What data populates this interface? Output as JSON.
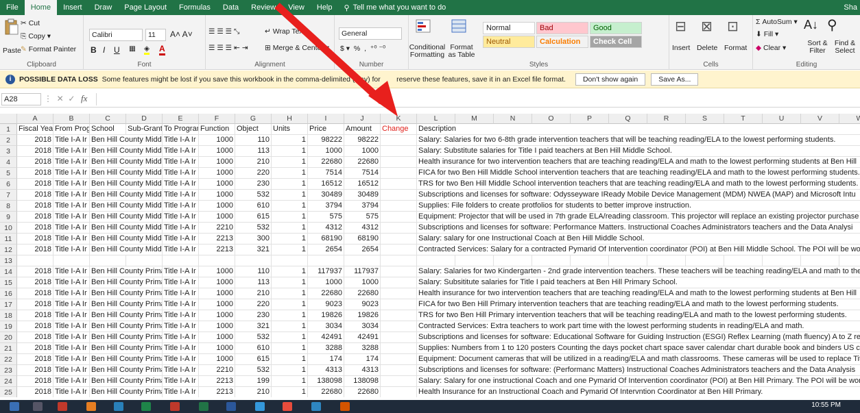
{
  "tabs": [
    "File",
    "Home",
    "Insert",
    "Draw",
    "Page Layout",
    "Formulas",
    "Data",
    "Review",
    "View",
    "Help"
  ],
  "tell_me": "Tell me what you want to do",
  "share": "Sha",
  "clipboard": {
    "paste": "Paste",
    "cut": "Cut",
    "copy": "Copy",
    "format_painter": "Format Painter",
    "label": "Clipboard"
  },
  "font": {
    "name": "Calibri",
    "size": "11",
    "label": "Font",
    "bold": "B",
    "italic": "I",
    "underline": "U"
  },
  "alignment": {
    "wrap": "Wrap Text",
    "merge": "Merge & Center",
    "label": "Alignment"
  },
  "number": {
    "format": "General",
    "label": "Number",
    "dollar": "$",
    "percent": "%",
    "comma": ","
  },
  "styles": {
    "conditional": "Conditional Formatting",
    "format_table": "Format as Table",
    "cells": [
      {
        "label": "Normal",
        "bg": "#ffffff",
        "fg": "#222222"
      },
      {
        "label": "Bad",
        "bg": "#ffc7ce",
        "fg": "#9c0006"
      },
      {
        "label": "Good",
        "bg": "#c6efce",
        "fg": "#006100"
      },
      {
        "label": "Neutral",
        "bg": "#ffeb9c",
        "fg": "#9c5700"
      },
      {
        "label": "Calculation",
        "bg": "#f2f2f2",
        "fg": "#fa7d00"
      },
      {
        "label": "Check Cell",
        "bg": "#a5a5a5",
        "fg": "#ffffff"
      }
    ],
    "label": "Styles"
  },
  "cells_group": {
    "insert": "Insert",
    "delete": "Delete",
    "format": "Format",
    "label": "Cells"
  },
  "editing": {
    "autosum": "AutoSum",
    "fill": "Fill",
    "clear": "Clear",
    "sort": "Sort & Filter",
    "find": "Find & Select",
    "label": "Editing"
  },
  "message": {
    "title": "POSSIBLE DATA LOSS",
    "text": "Some features might be lost if you save this workbook in the comma-delimited (.csv) for",
    "text2": "reserve these features, save it in an Excel file format.",
    "btn1": "Don't show again",
    "btn2": "Save As..."
  },
  "name_box": "A28",
  "fx": "fx",
  "columns": [
    "A",
    "B",
    "C",
    "D",
    "E",
    "F",
    "G",
    "H",
    "I",
    "J",
    "K",
    "L",
    "M",
    "N",
    "O",
    "P",
    "Q",
    "R",
    "S",
    "T",
    "U",
    "V",
    "W"
  ],
  "headers": [
    "Fiscal Year",
    "From Prog",
    "School",
    "Sub-Grant",
    "To Program",
    "Function",
    "Object",
    "Units",
    "Price",
    "Amount",
    "Change",
    "Description"
  ],
  "rows": [
    {
      "n": "1"
    },
    {
      "n": "2",
      "y": "2018",
      "p": "Title I-A  Ir",
      "s": "Ben Hill County Middl",
      "t": "Title I-A  Ir",
      "f": "1000",
      "o": "110",
      "u": "1",
      "pr": "98222",
      "a": "98222",
      "d": "Salary:  Salaries for two 6-8th grade intervention teachers that will be teaching reading/ELA to the lowest performing students."
    },
    {
      "n": "3",
      "y": "2018",
      "p": "Title I-A  Ir",
      "s": "Ben Hill County Middl",
      "t": "Title I-A  Ir",
      "f": "1000",
      "o": "113",
      "u": "1",
      "pr": "1000",
      "a": "1000",
      "d": "Salary:  Substitute salaries for Title I paid teachers at Ben Hill Middle School."
    },
    {
      "n": "4",
      "y": "2018",
      "p": "Title I-A  Ir",
      "s": "Ben Hill County Middl",
      "t": "Title I-A  Ir",
      "f": "1000",
      "o": "210",
      "u": "1",
      "pr": "22680",
      "a": "22680",
      "d": "Health insurance for two intervention teachers that are teaching reading/ELA and math to the lowest performing students at Ben Hill"
    },
    {
      "n": "5",
      "y": "2018",
      "p": "Title I-A  Ir",
      "s": "Ben Hill County Middl",
      "t": "Title I-A  Ir",
      "f": "1000",
      "o": "220",
      "u": "1",
      "pr": "7514",
      "a": "7514",
      "d": "FICA for two Ben Hill Middle School intervention teachers that are teaching reading/ELA and math to the lowest performing students."
    },
    {
      "n": "6",
      "y": "2018",
      "p": "Title I-A  Ir",
      "s": "Ben Hill County Middl",
      "t": "Title I-A  Ir",
      "f": "1000",
      "o": "230",
      "u": "1",
      "pr": "16512",
      "a": "16512",
      "d": "TRS for two Ben Hill Middle School intervention teachers that are teaching reading/ELA and math to the lowest performing students."
    },
    {
      "n": "7",
      "y": "2018",
      "p": "Title I-A  Ir",
      "s": "Ben Hill County Middl",
      "t": "Title I-A  Ir",
      "f": "1000",
      "o": "532",
      "u": "1",
      "pr": "30489",
      "a": "30489",
      "d": "Subscriptions and licenses for software:  Odysseyware  IReady  Mobile Device Management (MDM)  NWEA (MAP)  and Microsoft Intu"
    },
    {
      "n": "8",
      "y": "2018",
      "p": "Title I-A  Ir",
      "s": "Ben Hill County Middl",
      "t": "Title I-A  Ir",
      "f": "1000",
      "o": "610",
      "u": "1",
      "pr": "3794",
      "a": "3794",
      "d": "Supplies:  File folders to create protfolios for students to better improve instruction."
    },
    {
      "n": "9",
      "y": "2018",
      "p": "Title I-A  Ir",
      "s": "Ben Hill County Middl",
      "t": "Title I-A  Ir",
      "f": "1000",
      "o": "615",
      "u": "1",
      "pr": "575",
      "a": "575",
      "d": "Equipment:  Projector that will be used in 7th grade ELA/reading classroom.  This projector will replace an existing projector purchase"
    },
    {
      "n": "10",
      "y": "2018",
      "p": "Title I-A  Ir",
      "s": "Ben Hill County Middl",
      "t": "Title I-A  Ir",
      "f": "2210",
      "o": "532",
      "u": "1",
      "pr": "4312",
      "a": "4312",
      "d": "Subscriptions and licenses for software:  Performance Matters.  Instructional Coaches  Administrators  teachers  and the Data Analysi"
    },
    {
      "n": "11",
      "y": "2018",
      "p": "Title I-A  Ir",
      "s": "Ben Hill County Middl",
      "t": "Title I-A  Ir",
      "f": "2213",
      "o": "300",
      "u": "1",
      "pr": "68190",
      "a": "68190",
      "d": "Salary:  salary for one Instructional Coach at Ben Hill Middle School."
    },
    {
      "n": "12",
      "y": "2018",
      "p": "Title I-A  Ir",
      "s": "Ben Hill County Middl",
      "t": "Title I-A  Ir",
      "f": "2213",
      "o": "321",
      "u": "1",
      "pr": "2654",
      "a": "2654",
      "d": "Contracted Services:  Salary for a contracted Pymarid Of Intervention coordinator (POI) at Ben Hill Middle School.  The POI will be wo"
    },
    {
      "n": "13"
    },
    {
      "n": "14",
      "y": "2018",
      "p": "Title I-A  Ir",
      "s": "Ben Hill County Prima",
      "t": "Title I-A  Ir",
      "f": "1000",
      "o": "110",
      "u": "1",
      "pr": "117937",
      "a": "117937",
      "d": "Salary:  Salaries for two Kindergarten - 2nd grade intervention teachers.  These teachers will be teaching reading/ELA and math to the"
    },
    {
      "n": "15",
      "y": "2018",
      "p": "Title I-A  Ir",
      "s": "Ben Hill County Prima",
      "t": "Title I-A  Ir",
      "f": "1000",
      "o": "113",
      "u": "1",
      "pr": "1000",
      "a": "1000",
      "d": "Salary:  Subsititute salaries for Title I paid teachers at Ben Hill Primary School."
    },
    {
      "n": "16",
      "y": "2018",
      "p": "Title I-A  Ir",
      "s": "Ben Hill County Prima",
      "t": "Title I-A  Ir",
      "f": "1000",
      "o": "210",
      "u": "1",
      "pr": "22680",
      "a": "22680",
      "d": "Health insurance for two intervention teachers that are teaching reading/ELA and math to the lowest performing students at Ben Hill"
    },
    {
      "n": "17",
      "y": "2018",
      "p": "Title I-A  Ir",
      "s": "Ben Hill County Prima",
      "t": "Title I-A  Ir",
      "f": "1000",
      "o": "220",
      "u": "1",
      "pr": "9023",
      "a": "9023",
      "d": "FICA for two Ben Hill Primary intervention teachers that are teaching reading/ELA and math to the lowest performing students."
    },
    {
      "n": "18",
      "y": "2018",
      "p": "Title I-A  Ir",
      "s": "Ben Hill County Prima",
      "t": "Title I-A  Ir",
      "f": "1000",
      "o": "230",
      "u": "1",
      "pr": "19826",
      "a": "19826",
      "d": "TRS for two Ben Hill Primary intervention teachers that will be teaching reading/ELA and math to the lowest performing students."
    },
    {
      "n": "19",
      "y": "2018",
      "p": "Title I-A  Ir",
      "s": "Ben Hill County Prima",
      "t": "Title I-A  Ir",
      "f": "1000",
      "o": "321",
      "u": "1",
      "pr": "3034",
      "a": "3034",
      "d": "Contracted Services:  Extra teachers to work part time with the lowest performing students in reading/ELA and math."
    },
    {
      "n": "20",
      "y": "2018",
      "p": "Title I-A  Ir",
      "s": "Ben Hill County Prima",
      "t": "Title I-A  Ir",
      "f": "1000",
      "o": "532",
      "u": "1",
      "pr": "42491",
      "a": "42491",
      "d": "Subscriptions and licenses for software:  Educational Software for Guiding Instruction (ESGI)  Reflex Learning (math fluency)  A to Z re"
    },
    {
      "n": "21",
      "y": "2018",
      "p": "Title I-A  Ir",
      "s": "Ben Hill County Prima",
      "t": "Title I-A  Ir",
      "f": "1000",
      "o": "610",
      "u": "1",
      "pr": "3288",
      "a": "3288",
      "d": "Supplies:  Numbers from 1 to 120 posters  Counting the days pocket chart  space saver calendar chart  durable book and binders  US c"
    },
    {
      "n": "22",
      "y": "2018",
      "p": "Title I-A  Ir",
      "s": "Ben Hill County Prima",
      "t": "Title I-A  Ir",
      "f": "1000",
      "o": "615",
      "u": "1",
      "pr": "174",
      "a": "174",
      "d": "Equipment:  Document cameras  that will be utilized in a reading/ELA and math classrooms.  These cameras will be used to replace Tit"
    },
    {
      "n": "23",
      "y": "2018",
      "p": "Title I-A  Ir",
      "s": "Ben Hill County Prima",
      "t": "Title I-A  Ir",
      "f": "2210",
      "o": "532",
      "u": "1",
      "pr": "4313",
      "a": "4313",
      "d": "Subscriptions and licenses for software:  (Performanc Matters) Instructional Coaches  Administrators  teachers  and the Data Analysis"
    },
    {
      "n": "24",
      "y": "2018",
      "p": "Title I-A  Ir",
      "s": "Ben Hill County Prima",
      "t": "Title I-A  Ir",
      "f": "2213",
      "o": "199",
      "u": "1",
      "pr": "138098",
      "a": "138098",
      "d": "Salary:  Salary for one instructional Coach and one Pymarid Of Intervention coordinator (POI) at Ben Hill Primary.  The POI will be wor"
    },
    {
      "n": "25",
      "y": "2018",
      "p": "Title I-A  Ir",
      "s": "Ben Hill County Prima",
      "t": "Title I-A  Ir",
      "f": "2213",
      "o": "210",
      "u": "1",
      "pr": "22680",
      "a": "22680",
      "d": "Health Insurance for an Instructional Coach and Pymarid Of Intervntion Coordinator at Ben Hill Primary."
    }
  ],
  "clock": "10:55 PM",
  "colors": {
    "excel_green": "#217346",
    "change_red": "#e0201b",
    "arrow_red": "#e8201d"
  }
}
